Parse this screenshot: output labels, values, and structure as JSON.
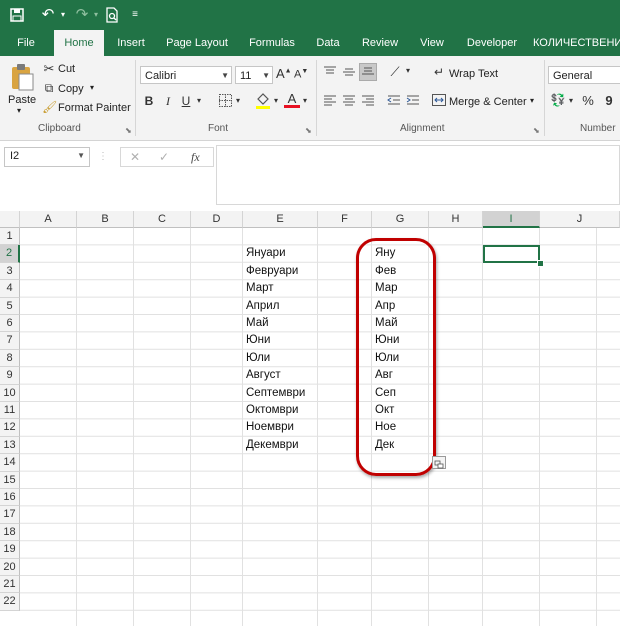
{
  "quick_access": {
    "icons": [
      "save-icon",
      "undo-icon",
      "undo-dropdown-icon",
      "redo-icon",
      "redo-dropdown-icon",
      "print-preview-icon",
      "customize-dropdown-icon"
    ]
  },
  "tabs": [
    {
      "label": "File",
      "active": false
    },
    {
      "label": "Home",
      "active": true
    },
    {
      "label": "Insert",
      "active": false
    },
    {
      "label": "Page Layout",
      "active": false
    },
    {
      "label": "Formulas",
      "active": false
    },
    {
      "label": "Data",
      "active": false
    },
    {
      "label": "Review",
      "active": false
    },
    {
      "label": "View",
      "active": false
    },
    {
      "label": "Developer",
      "active": false
    },
    {
      "label": "КОЛИЧЕСТВЕНИ",
      "active": false
    }
  ],
  "ribbon": {
    "clipboard": {
      "paste": "Paste",
      "cut": "Cut",
      "copy": "Copy",
      "format_painter": "Format Painter",
      "group_label": "Clipboard"
    },
    "font": {
      "font_name": "Calibri",
      "font_size": "11",
      "bold": "B",
      "italic": "I",
      "underline": "U",
      "font_color_letter": "A",
      "grow_letter": "A",
      "shrink_letter": "A",
      "group_label": "Font"
    },
    "alignment": {
      "wrap_text": "Wrap Text",
      "merge_center": "Merge & Center",
      "group_label": "Alignment"
    },
    "number": {
      "format": "General",
      "percent": "%",
      "comma": "9",
      "group_label": "Number"
    },
    "accent_color": "#217346",
    "font_color_bar": "#e81123",
    "fill_color_bar": "#ffff00"
  },
  "formula_bar": {
    "name_box": "I2",
    "cancel_symbol": "✕",
    "enter_symbol": "✓",
    "function_symbol": "fx",
    "formula": ""
  },
  "grid": {
    "columns": [
      "",
      "A",
      "B",
      "C",
      "D",
      "E",
      "F",
      "G",
      "H",
      "I",
      "J"
    ],
    "selected_column": "I",
    "rows": [
      "1",
      "2",
      "3",
      "4",
      "5",
      "6",
      "7",
      "8",
      "9",
      "10",
      "11",
      "12",
      "13",
      "14",
      "15",
      "16",
      "17",
      "18",
      "19",
      "20",
      "21",
      "22"
    ],
    "selected_row": "2",
    "months_full": [
      "Януари",
      "Февруари",
      "Март",
      "Април",
      "Май",
      "Юни",
      "Юли",
      "Август",
      "Септември",
      "Октомври",
      "Ноември",
      "Декември"
    ],
    "months_short": [
      "Яну",
      "Фев",
      "Мар",
      "Апр",
      "Май",
      "Юни",
      "Юли",
      "Авг",
      "Сеп",
      "Окт",
      "Ное",
      "Дек"
    ],
    "highlight_color": "#c00000"
  }
}
